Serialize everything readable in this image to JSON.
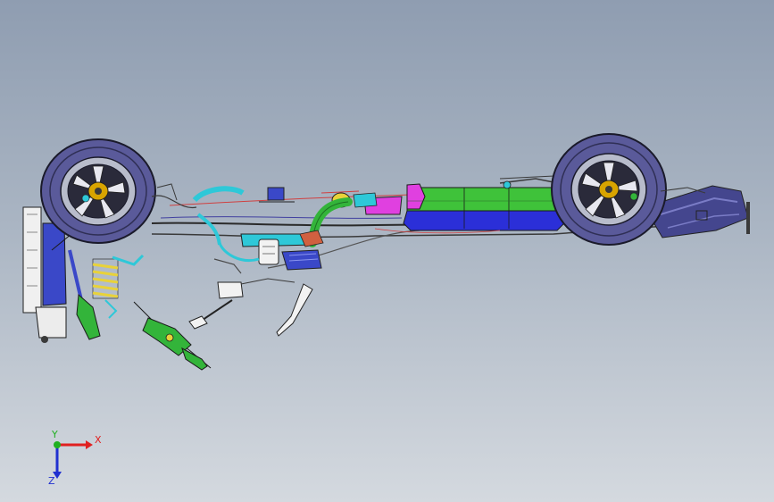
{
  "viewport": {
    "background_top": "#8f9db1",
    "background_bottom": "#d4d9df"
  },
  "model": {
    "colors": {
      "tire": "#5a5a9a",
      "rim": "#b8bccb",
      "hub": "#d8a400",
      "fuel_tank_top": "#3fc23a",
      "fuel_tank_bottom": "#2b2fd8",
      "magenta_part": "#e040e0",
      "cyan_part": "#2ec8d8",
      "frame": "#2a2a2a",
      "coil_spring": "#e8d23a",
      "green_component": "#33b43a",
      "blue_component": "#3a48c8"
    }
  },
  "triad": {
    "x_label": "X",
    "y_label": "Y",
    "z_label": "Z",
    "x_color": "#e02020",
    "y_color": "#20b020",
    "z_color": "#2030d0"
  }
}
